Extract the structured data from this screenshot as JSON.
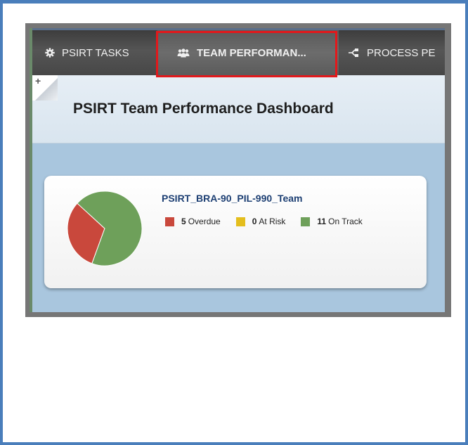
{
  "tabs": {
    "psirt_tasks": "PSIRT TASKS",
    "team_performance": "TEAM PERFORMAN...",
    "process": "PROCESS PE"
  },
  "page_title": "PSIRT Team Performance Dashboard",
  "team_card": {
    "title": "PSIRT_BRA-90_PIL-990_Team",
    "legend": [
      {
        "count": "5",
        "label": "Overdue",
        "color": "#c9483c"
      },
      {
        "count": "0",
        "label": "At Risk",
        "color": "#e4be1d"
      },
      {
        "count": "11",
        "label": "On Track",
        "color": "#6ea05a"
      }
    ]
  },
  "chart_data": {
    "type": "pie",
    "labels": [
      "Overdue",
      "At Risk",
      "On Track"
    ],
    "values": [
      5,
      0,
      11
    ],
    "colors": [
      "#c9483c",
      "#e4be1d",
      "#6ea05a"
    ]
  },
  "colors": {
    "highlight_box": "#e3181b",
    "frame_border": "#4a7ebb",
    "tabbar": "#4a4a4a"
  },
  "icons": {
    "tasks": "gear-icon",
    "team": "users-icon",
    "process": "process-flow-icon",
    "panel": "add-panel-icon"
  }
}
